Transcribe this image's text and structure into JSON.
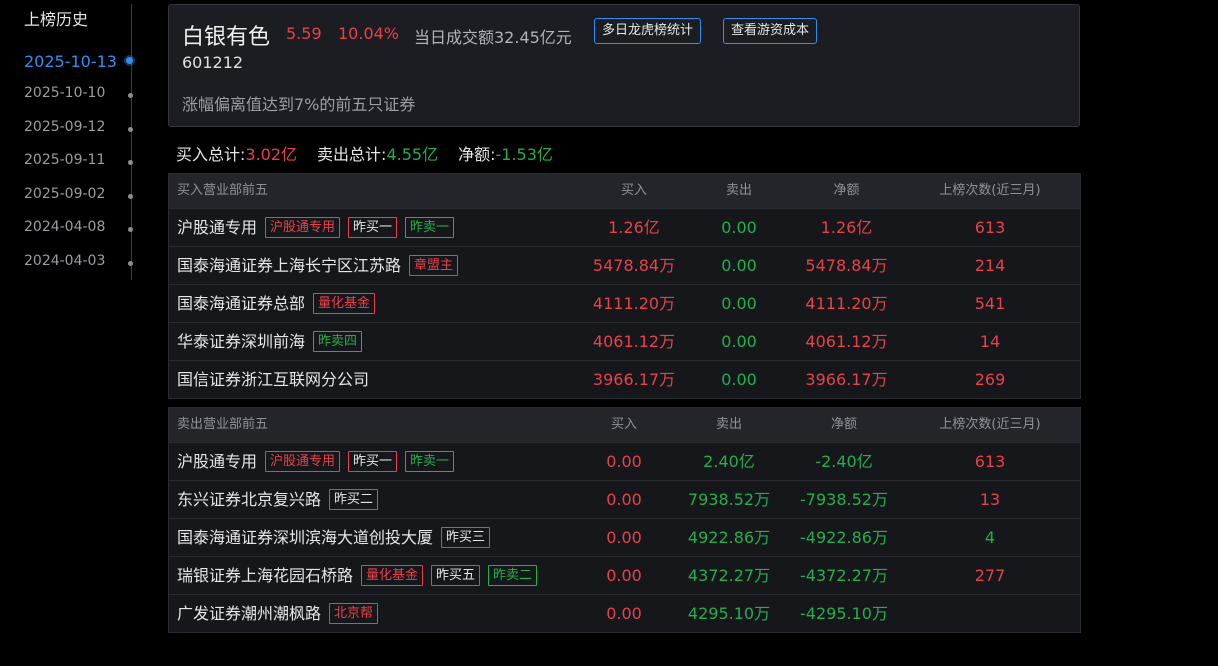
{
  "sidebar": {
    "title": "上榜历史",
    "dates": [
      "2025-10-13",
      "2025-10-10",
      "2025-09-12",
      "2025-09-11",
      "2025-09-02",
      "2024-04-08",
      "2024-04-03"
    ],
    "active_index": 0
  },
  "stock": {
    "name": "白银有色",
    "price": "5.59",
    "change_pct": "10.04%",
    "turnover": "当日成交额32.45亿元",
    "code": "601212",
    "reason": "涨幅偏离值达到7%的前五只证券",
    "btn_multi": "多日龙虎榜统计",
    "btn_cost": "查看游资成本"
  },
  "summary": {
    "buy_label": "买入总计:",
    "buy_value": "3.02亿",
    "sell_label": "卖出总计:",
    "sell_value": "4.55亿",
    "net_label": "净额:",
    "net_value": "-1.53亿"
  },
  "buy_table": {
    "headers": [
      "买入营业部前五",
      "买入",
      "卖出",
      "净额",
      "上榜次数(近三月)"
    ],
    "rows": [
      {
        "name": "沪股通专用",
        "badges": [
          {
            "text": "沪股通专用",
            "color": "red"
          },
          {
            "text": "昨买一",
            "color": "white"
          },
          {
            "text": "昨卖一",
            "color": "green"
          }
        ],
        "buy": "1.26亿",
        "sell": "0.00",
        "net": "1.26亿",
        "times": "613",
        "times_color": "red"
      },
      {
        "name": "国泰海通证券上海长宁区江苏路",
        "badges": [
          {
            "text": "章盟主",
            "color": "red"
          }
        ],
        "buy": "5478.84万",
        "sell": "0.00",
        "net": "5478.84万",
        "times": "214",
        "times_color": "red"
      },
      {
        "name": "国泰海通证券总部",
        "badges": [
          {
            "text": "量化基金",
            "color": "red"
          }
        ],
        "buy": "4111.20万",
        "sell": "0.00",
        "net": "4111.20万",
        "times": "541",
        "times_color": "red"
      },
      {
        "name": "华泰证券深圳前海",
        "badges": [
          {
            "text": "昨卖四",
            "color": "green"
          }
        ],
        "buy": "4061.12万",
        "sell": "0.00",
        "net": "4061.12万",
        "times": "14",
        "times_color": "red"
      },
      {
        "name": "国信证券浙江互联网分公司",
        "badges": [],
        "buy": "3966.17万",
        "sell": "0.00",
        "net": "3966.17万",
        "times": "269",
        "times_color": "red"
      }
    ]
  },
  "sell_table": {
    "headers": [
      "卖出营业部前五",
      "买入",
      "卖出",
      "净额",
      "上榜次数(近三月)"
    ],
    "rows": [
      {
        "name": "沪股通专用",
        "badges": [
          {
            "text": "沪股通专用",
            "color": "red"
          },
          {
            "text": "昨买一",
            "color": "white"
          },
          {
            "text": "昨卖一",
            "color": "green"
          }
        ],
        "buy": "0.00",
        "sell": "2.40亿",
        "net": "-2.40亿",
        "times": "613",
        "times_color": "red"
      },
      {
        "name": "东兴证券北京复兴路",
        "badges": [
          {
            "text": "昨买二",
            "color": "white"
          }
        ],
        "buy": "0.00",
        "sell": "7938.52万",
        "net": "-7938.52万",
        "times": "13",
        "times_color": "red"
      },
      {
        "name": "国泰海通证券深圳滨海大道创投大厦",
        "badges": [
          {
            "text": "昨买三",
            "color": "white"
          }
        ],
        "buy": "0.00",
        "sell": "4922.86万",
        "net": "-4922.86万",
        "times": "4",
        "times_color": "green"
      },
      {
        "name": "瑞银证券上海花园石桥路",
        "badges": [
          {
            "text": "量化基金",
            "color": "red"
          },
          {
            "text": "昨买五",
            "color": "white"
          },
          {
            "text": "昨卖二",
            "color": "green"
          }
        ],
        "buy": "0.00",
        "sell": "4372.27万",
        "net": "-4372.27万",
        "times": "277",
        "times_color": "red"
      },
      {
        "name": "广发证券潮州潮枫路",
        "badges": [
          {
            "text": "北京帮",
            "color": "red"
          }
        ],
        "buy": "0.00",
        "sell": "4295.10万",
        "net": "-4295.10万",
        "times": "",
        "times_color": "red"
      }
    ]
  },
  "colors": {
    "up": "#e8414b",
    "down": "#21b04b",
    "accent": "#2f8ff0",
    "background": "#000000",
    "panel": "#1c1d22"
  }
}
